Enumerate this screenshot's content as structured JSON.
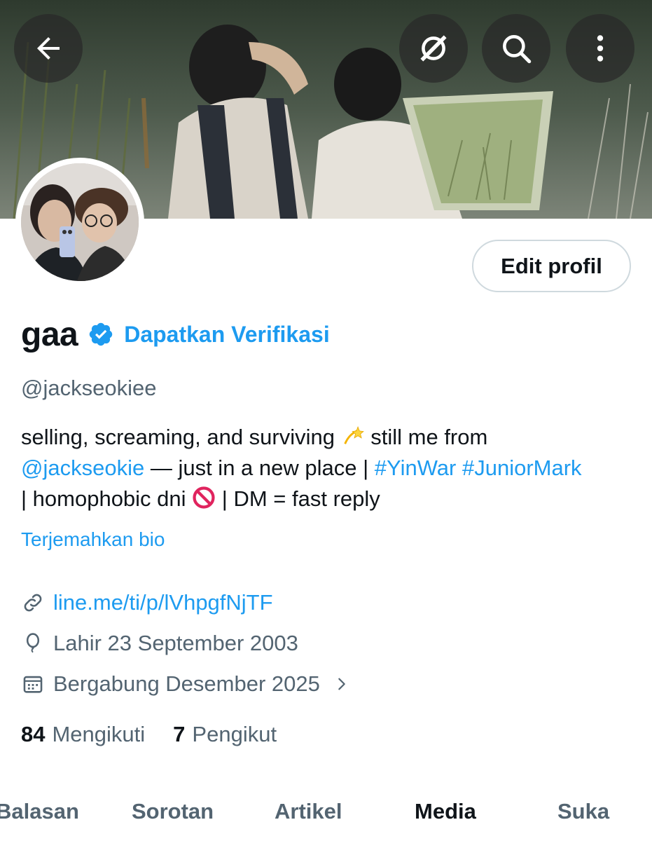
{
  "profile": {
    "display_name": "gaa",
    "get_verified": "Dapatkan Verifikasi",
    "handle": "@jackseokiee",
    "edit_button": "Edit profil"
  },
  "bio": {
    "line1_text": "selling, screaming, and surviving",
    "line1_emoji": "dizzy-emoji",
    "line1_tail": "still me from",
    "mention": "@jackseokie",
    "line2_mid": "— just in a new place |",
    "hashtag1": "#YinWar",
    "hashtag2": "#JuniorMark",
    "line3_head": "| homophobic dni",
    "line3_emoji": "prohibited-emoji",
    "line3_tail": "| DM = fast reply"
  },
  "translate_bio": "Terjemahkan bio",
  "meta": {
    "link": "line.me/ti/p/lVhpgfNjTF",
    "born": "Lahir 23 September 2003",
    "joined": "Bergabung Desember 2025"
  },
  "stats": {
    "following_count": "84",
    "following_label": "Mengikuti",
    "followers_count": "7",
    "followers_label": "Pengikut"
  },
  "tabs": [
    {
      "label": "Balasan",
      "active": false
    },
    {
      "label": "Sorotan",
      "active": false
    },
    {
      "label": "Artikel",
      "active": false
    },
    {
      "label": "Media",
      "active": true
    },
    {
      "label": "Suka",
      "active": false
    }
  ],
  "icons": {
    "back": "arrow-left-icon",
    "grok": "grok-icon",
    "search": "search-icon",
    "more": "more-vertical-icon",
    "verified": "verified-badge-icon",
    "link": "link-icon",
    "born": "balloon-icon",
    "joined": "calendar-icon",
    "chevron": "chevron-right-icon"
  },
  "colors": {
    "accent": "#1d9bf0",
    "text_primary": "#0f1419",
    "text_secondary": "#536471"
  }
}
